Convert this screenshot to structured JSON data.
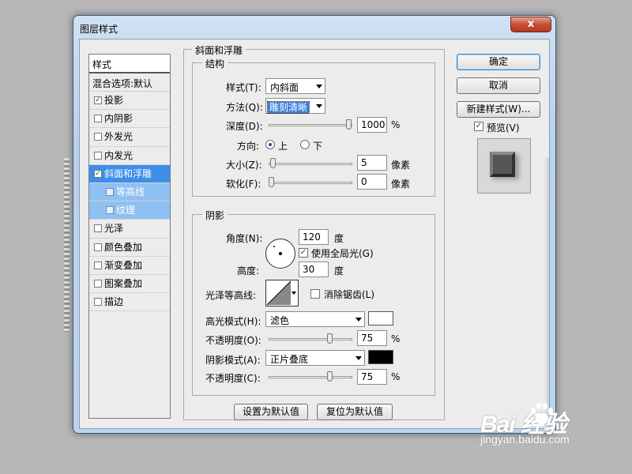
{
  "window": {
    "title": "图层样式",
    "close": "x"
  },
  "style_list": {
    "header": "样式",
    "blend": "混合选项:默认",
    "items": [
      {
        "label": "投影",
        "checked": true
      },
      {
        "label": "内阴影",
        "checked": false
      },
      {
        "label": "外发光",
        "checked": false
      },
      {
        "label": "内发光",
        "checked": false
      },
      {
        "label": "斜面和浮雕",
        "checked": true,
        "selected": true
      },
      {
        "label": "等高线",
        "checked": false,
        "sub": true
      },
      {
        "label": "纹理",
        "checked": false,
        "sub": true
      },
      {
        "label": "光泽",
        "checked": false
      },
      {
        "label": "颜色叠加",
        "checked": false
      },
      {
        "label": "渐变叠加",
        "checked": false
      },
      {
        "label": "图案叠加",
        "checked": false
      },
      {
        "label": "描边",
        "checked": false
      }
    ]
  },
  "bevel": {
    "group_title": "斜面和浮雕",
    "structure": {
      "title": "结构",
      "style_label": "样式(T):",
      "style_value": "内斜面",
      "technique_label": "方法(Q):",
      "technique_value": "雕刻清晰",
      "depth_label": "深度(D):",
      "depth_value": "1000",
      "depth_unit": "%",
      "depth_fraction": 1.0,
      "direction_label": "方向:",
      "direction_up": "上",
      "direction_down": "下",
      "direction_selected": "上",
      "size_label": "大小(Z):",
      "size_value": "5",
      "size_unit": "像素",
      "size_fraction": 0.02,
      "soften_label": "软化(F):",
      "soften_value": "0",
      "soften_unit": "像素",
      "soften_fraction": 0.0
    },
    "shading": {
      "title": "阴影",
      "angle_label": "角度(N):",
      "angle_value": "120",
      "angle_unit": "度",
      "global_light_label": "使用全局光(G)",
      "global_light_checked": true,
      "altitude_label": "高度:",
      "altitude_value": "30",
      "altitude_unit": "度",
      "gloss_label": "光泽等高线:",
      "antialias_label": "消除锯齿(L)",
      "antialias_checked": false,
      "highlight_mode_label": "高光模式(H):",
      "highlight_mode_value": "滤色",
      "highlight_color": "#ffffff",
      "highlight_opacity_label": "不透明度(O):",
      "highlight_opacity_value": "75",
      "highlight_opacity_unit": "%",
      "highlight_opacity_fraction": 0.75,
      "shadow_mode_label": "阴影模式(A):",
      "shadow_mode_value": "正片叠底",
      "shadow_color": "#000000",
      "shadow_opacity_label": "不透明度(C):",
      "shadow_opacity_value": "75",
      "shadow_opacity_unit": "%",
      "shadow_opacity_fraction": 0.75
    },
    "make_default": "设置为默认值",
    "reset_default": "复位为默认值"
  },
  "buttons": {
    "ok": "确定",
    "cancel": "取消",
    "new_style": "新建样式(W)...",
    "preview_label": "预览(V)",
    "preview_checked": true
  },
  "watermark": {
    "logo": "Bai  经验",
    "url": "jingyan.baidu.com"
  }
}
